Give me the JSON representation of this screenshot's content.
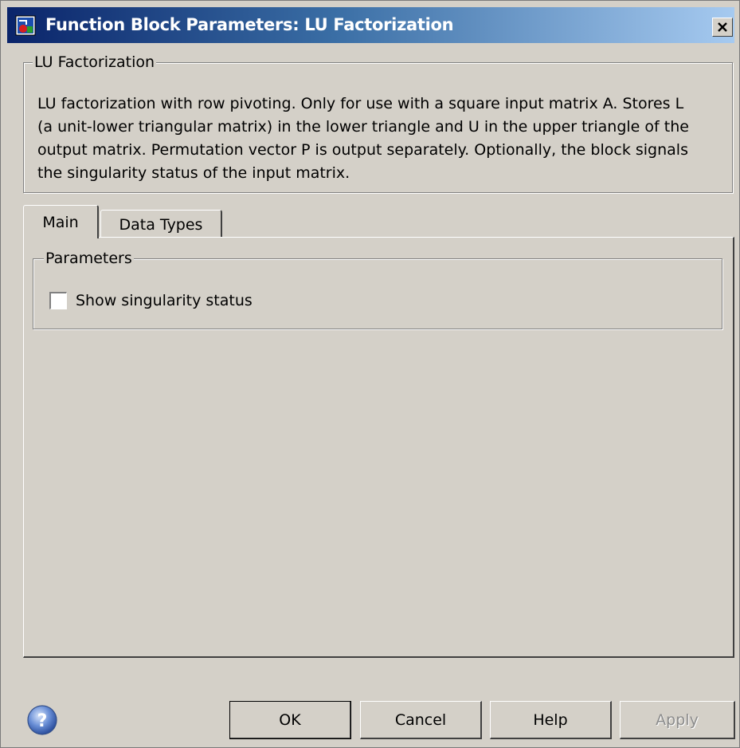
{
  "window": {
    "title": "Function Block Parameters: LU Factorization",
    "close_icon": "close-icon",
    "app_icon": "simulink-block-icon"
  },
  "description_group": {
    "legend": "LU Factorization",
    "lines": [
      "LU factorization with row pivoting.  Only for use with a square input matrix A.  Stores L",
      "(a unit-lower triangular matrix) in the lower triangle and U in the upper triangle of the",
      "output matrix.  Permutation vector P is output separately. Optionally, the block signals",
      "the singularity status of the input matrix."
    ]
  },
  "tabs": [
    {
      "label": "Main",
      "active": true
    },
    {
      "label": "Data Types",
      "active": false
    }
  ],
  "parameters_group": {
    "legend": "Parameters",
    "checkbox_label": "Show singularity status",
    "checkbox_checked": false
  },
  "buttons": {
    "help_icon": "help-question-icon",
    "ok": "OK",
    "cancel": "Cancel",
    "help": "Help",
    "apply": "Apply"
  },
  "colors": {
    "dialog_bg": "#d4d0c8",
    "title_gradient_start": "#0a246a",
    "title_gradient_end": "#a6caf0"
  }
}
